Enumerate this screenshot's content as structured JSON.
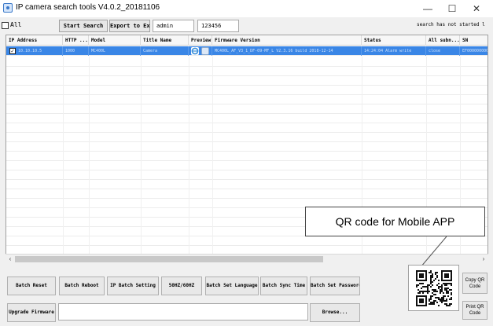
{
  "window": {
    "title": "IP camera search tools V4.0.2_20181106",
    "controls": [
      "—",
      "☐",
      "✕"
    ]
  },
  "toolbar": {
    "all_label": "All",
    "start_search": "Start Search",
    "export_excel": "Export to Excel",
    "username": "admin",
    "password": "123456",
    "status": "search has not started l"
  },
  "table": {
    "columns": [
      "IP Address",
      "HTTP ...",
      "Model",
      "Title Name",
      "Preview",
      "Firmware Version",
      "Status",
      "All subn...",
      "SN"
    ],
    "rows": [
      {
        "ip": "10.10.10.5",
        "http": "1000",
        "model": "MC400L",
        "title": "Camera",
        "firmware": "MC400L_AF_V3_1_DF-09-MF_L V2.3.16 build 2018-12-14",
        "status": "14:24:04 Alarm write",
        "subnet": "close",
        "sn": "EF000000000"
      }
    ]
  },
  "callout": {
    "text": "QR code for Mobile APP"
  },
  "bottom": {
    "batch_reset": "Batch Reset",
    "batch_reboot": "Batch Reboot",
    "ip_batch_setting": "IP Batch Setting",
    "freq": "50HZ/60HZ",
    "batch_set_language": "Batch Set Language",
    "batch_sync_time": "Batch Sync Time",
    "batch_set_password": "Batch Set Password",
    "upgrade_firmware": "Upgrade Firmware",
    "firmware_path": "",
    "browse": "Browse...",
    "copy_qr": "Copy QR Code",
    "print_qr": "Print QR Code"
  },
  "colors": {
    "selection": "#3a86e6",
    "ie_icon": "#3b8fd9"
  }
}
